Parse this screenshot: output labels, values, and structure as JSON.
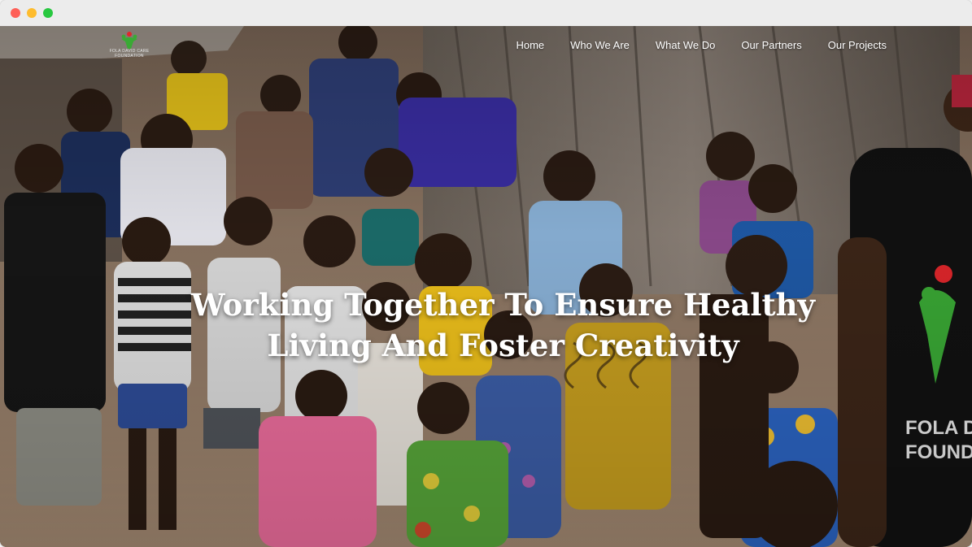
{
  "window": {
    "controls": [
      "close",
      "minimize",
      "maximize"
    ]
  },
  "logo": {
    "text": "FOLA DAVID CARE FOUNDATION",
    "icon": "people-heart-logo-icon",
    "color": "#3aa935"
  },
  "nav": {
    "items": [
      {
        "label": "Home"
      },
      {
        "label": "Who We Are"
      },
      {
        "label": "What We Do"
      },
      {
        "label": "Our Partners"
      },
      {
        "label": "Our Projects"
      }
    ]
  },
  "hero": {
    "headline_line1": "Working Together To Ensure Healthy",
    "headline_line2": "Living And Foster Creativity",
    "shirt_text_line1": "FOLA DA",
    "shirt_text_line2": "FOUNDAT"
  },
  "colors": {
    "nav_text": "#ffffff",
    "headline_text": "#ffffff",
    "logo_green": "#3aa935",
    "logo_red": "#e0262b"
  }
}
